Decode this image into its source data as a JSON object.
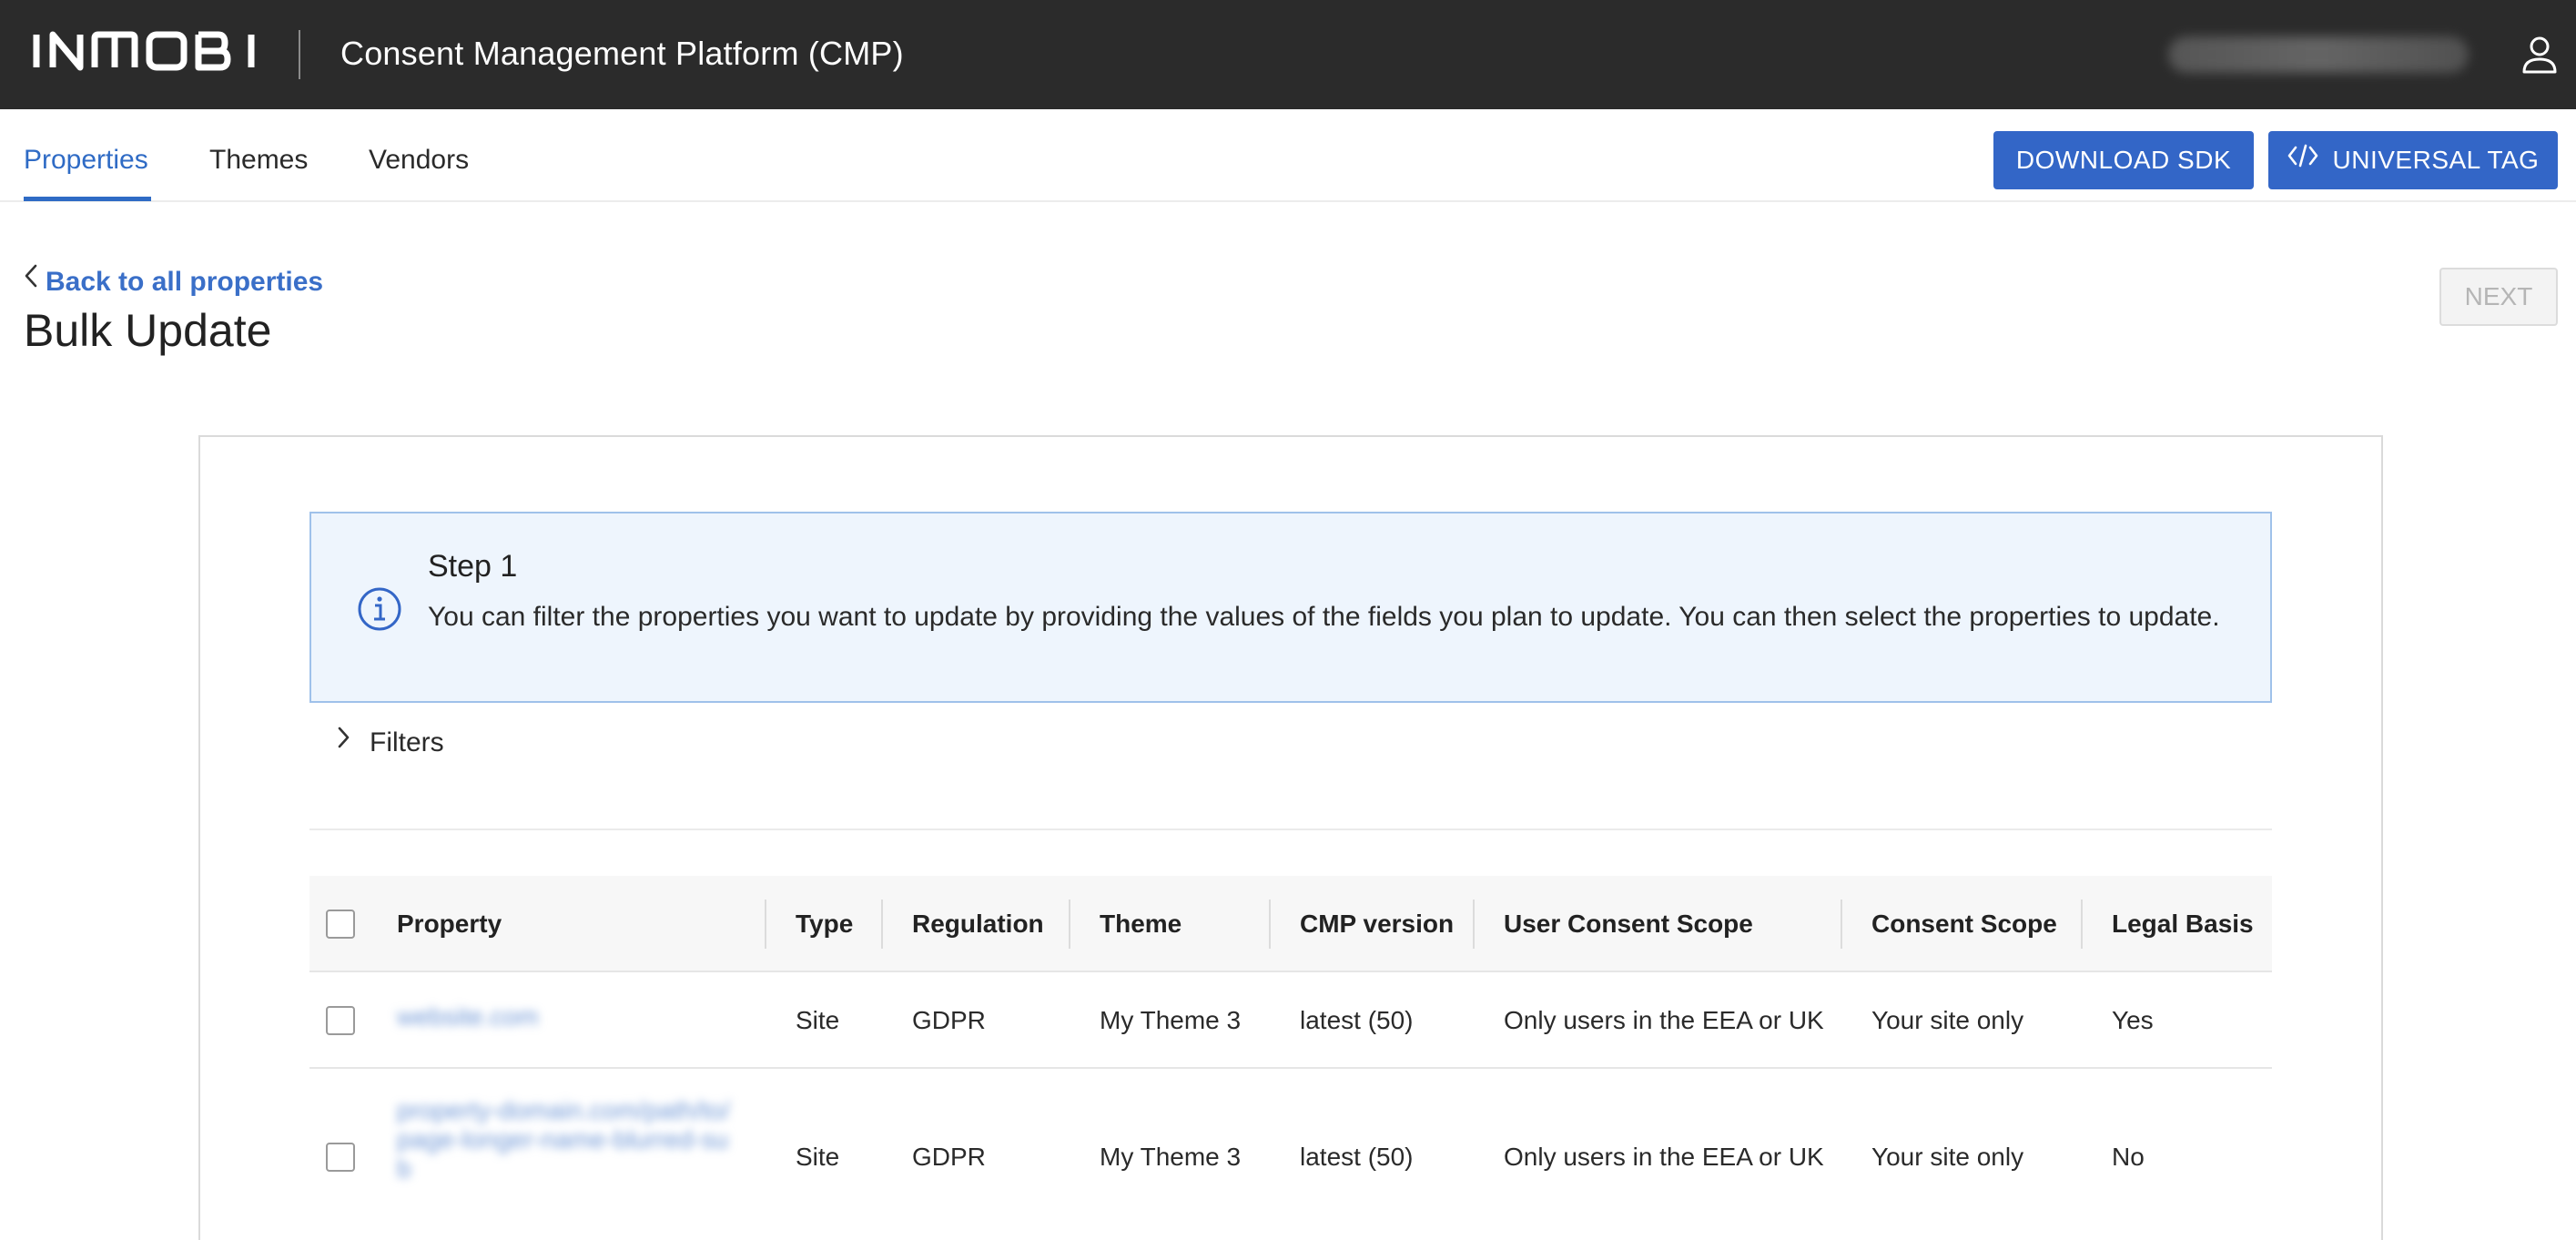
{
  "header": {
    "brand": "INMOBI",
    "app_title": "Consent Management Platform (CMP)",
    "user_email": "g••••@inmobi.com"
  },
  "tabs": [
    {
      "label": "Properties",
      "active": true
    },
    {
      "label": "Themes",
      "active": false
    },
    {
      "label": "Vendors",
      "active": false
    }
  ],
  "actions": {
    "download_sdk": "DOWNLOAD SDK",
    "universal_tag": "UNIVERSAL TAG"
  },
  "page": {
    "back_link": "Back to all properties",
    "title": "Bulk Update",
    "next_label": "NEXT"
  },
  "info": {
    "step_title": "Step 1",
    "step_text": "You can filter the properties you want to update by providing the values of the fields you plan to update. You can then select the properties to update."
  },
  "filters_label": "Filters",
  "table": {
    "columns": [
      "Property",
      "Type",
      "Regulation",
      "Theme",
      "CMP version",
      "User Consent Scope",
      "Consent Scope",
      "Legal Basis"
    ],
    "rows": [
      {
        "property": "website.com",
        "type": "Site",
        "regulation": "GDPR",
        "theme": "My Theme 3",
        "cmp_version": "latest (50)",
        "user_consent_scope": "Only users in the EEA or UK",
        "consent_scope": "Your site only",
        "legal_basis": "Yes"
      },
      {
        "property": "property-domain.com/path/to/page-longer-name-blurred-sub",
        "type": "Site",
        "regulation": "GDPR",
        "theme": "My Theme 3",
        "cmp_version": "latest (50)",
        "user_consent_scope": "Only users in the EEA or UK",
        "consent_scope": "Your site only",
        "legal_basis": "No"
      }
    ]
  },
  "colors": {
    "topbar": "#2b2b2b",
    "accent": "#3366c7",
    "info_bg": "#eef5fd",
    "info_border": "#9fc1ea"
  }
}
